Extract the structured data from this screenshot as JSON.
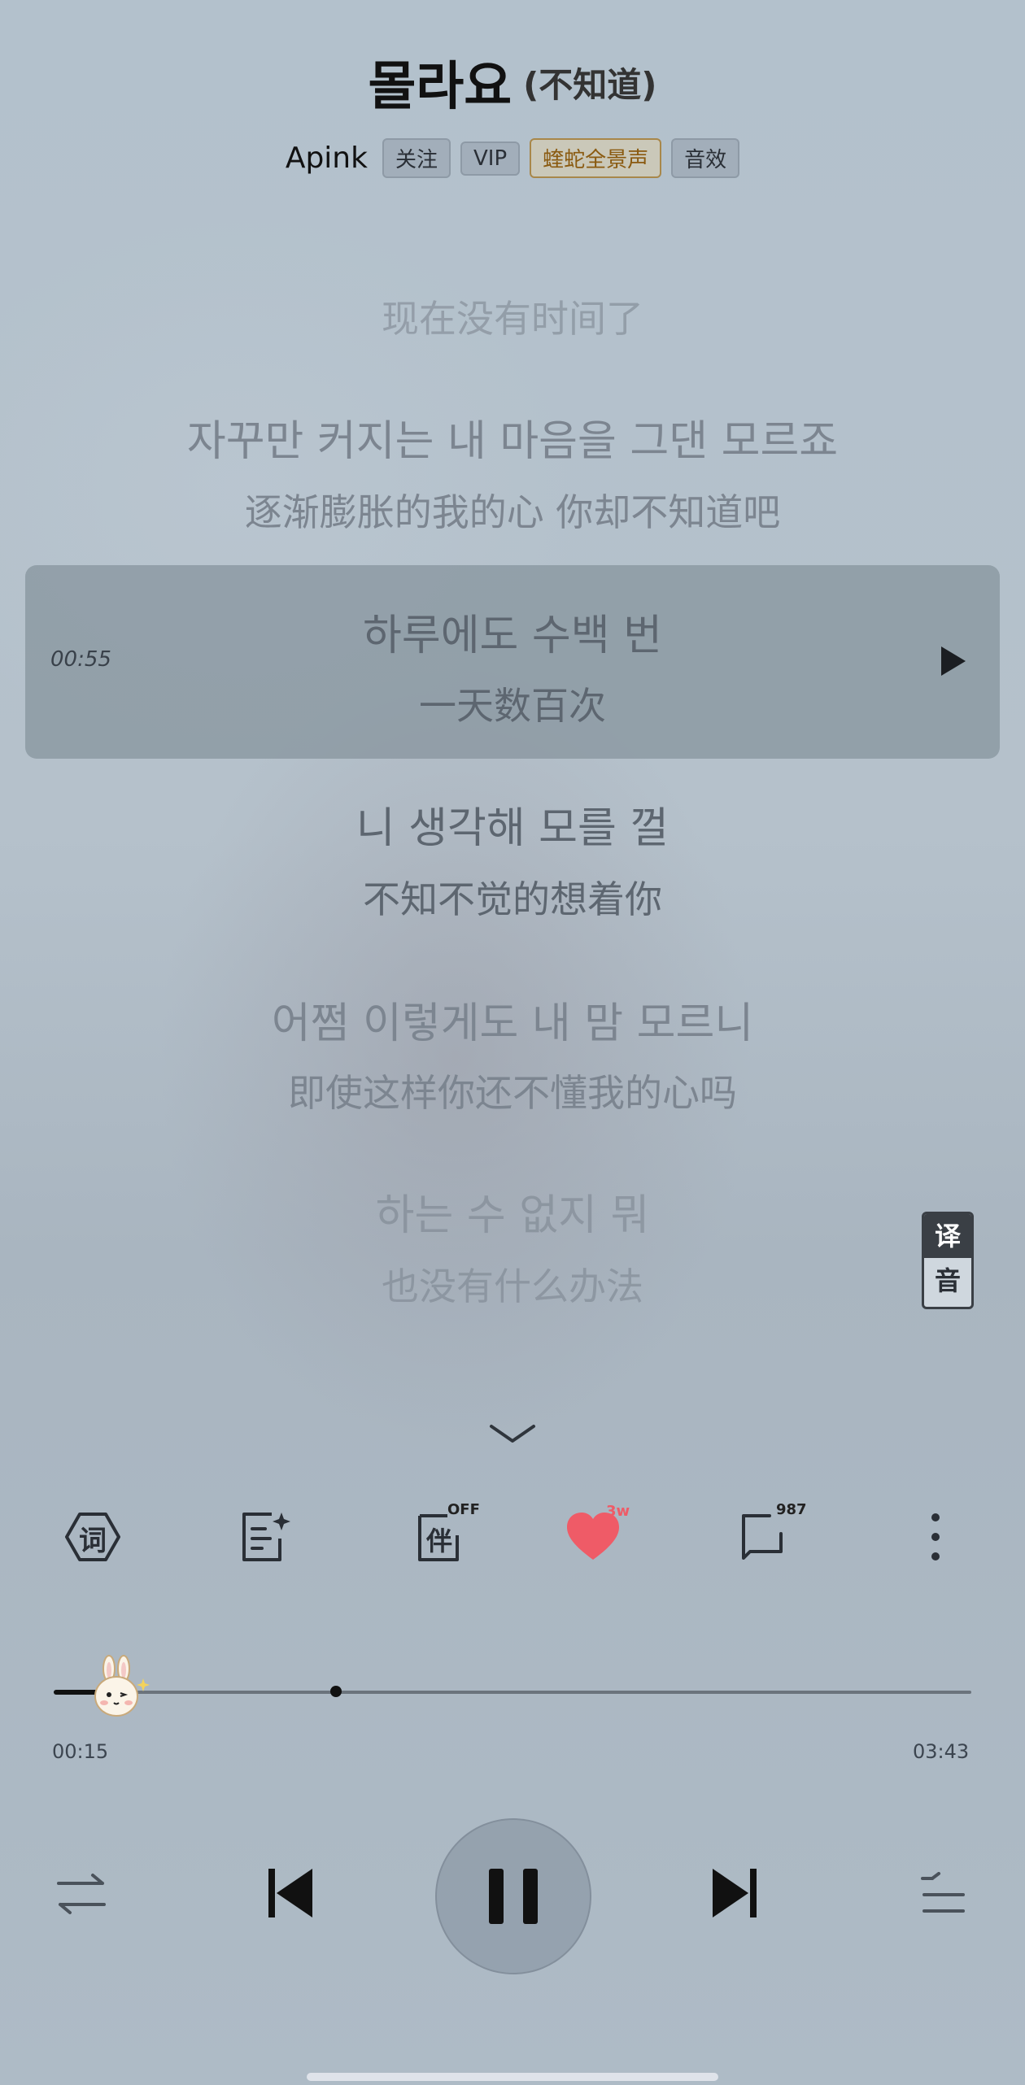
{
  "song": {
    "title": "몰라요",
    "title_translation": "(不知道)",
    "artist": "Apink",
    "tags": [
      "关注",
      "VIP",
      "蝰蛇全景声",
      "音效"
    ]
  },
  "lyrics": [
    {
      "text": "现在没有时间了"
    },
    {
      "text": "자꾸만 커지는 내 마음을 그댄 모르죠",
      "translation": "逐渐膨胀的我的心 你却不知道吧"
    },
    {
      "text": "하루에도 수백 번",
      "translation": "一天数百次",
      "time": "00:55"
    },
    {
      "text": "니 생각해 모를 껄",
      "translation": "不知不觉的想着你"
    },
    {
      "text": "어쩜 이렇게도 내 맘 모르니",
      "translation": "即使这样你还不懂我的心吗"
    },
    {
      "text": "하는 수 없지 뭐",
      "translation": "也没有什么办法"
    }
  ],
  "translate_toggle": {
    "top": "译",
    "bottom": "音"
  },
  "toolbar": {
    "lyrics_label": "词",
    "accompany_label": "伴",
    "accompany_state": "OFF",
    "like_count": "3w",
    "comment_count": "987"
  },
  "progress": {
    "current": "00:15",
    "total": "03:43",
    "fraction": 0.067
  },
  "colors": {
    "like": "#ef5b67",
    "accent_gold": "#8a5a10"
  }
}
